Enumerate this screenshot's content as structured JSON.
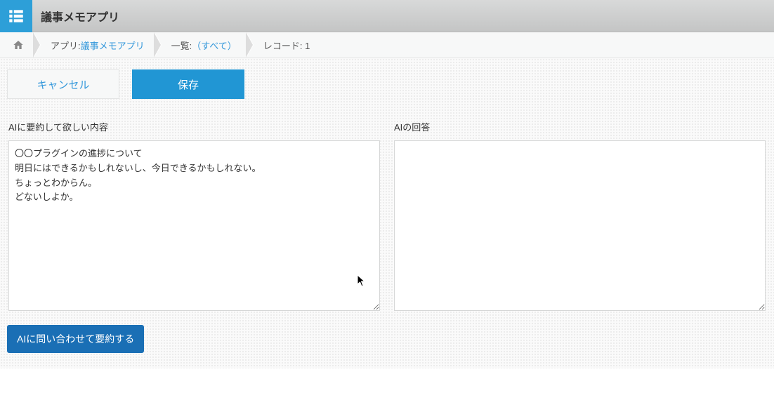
{
  "header": {
    "app_title": "議事メモアプリ"
  },
  "breadcrumb": {
    "app_prefix": "アプリ: ",
    "app_link": "議事メモアプリ",
    "list_prefix": "一覧: ",
    "list_link": "（すべて）",
    "record": "レコード: 1"
  },
  "actions": {
    "cancel": "キャンセル",
    "save": "保存"
  },
  "form": {
    "prompt_label": "AIに要約して欲しい内容",
    "prompt_value": "〇〇プラグインの進捗について\n明日にはできるかもしれないし、今日できるかもしれない。\nちょっとわからん。\nどないしよか。",
    "response_label": "AIの回答",
    "response_value": ""
  },
  "ai_button": "AIに問い合わせて要約する"
}
